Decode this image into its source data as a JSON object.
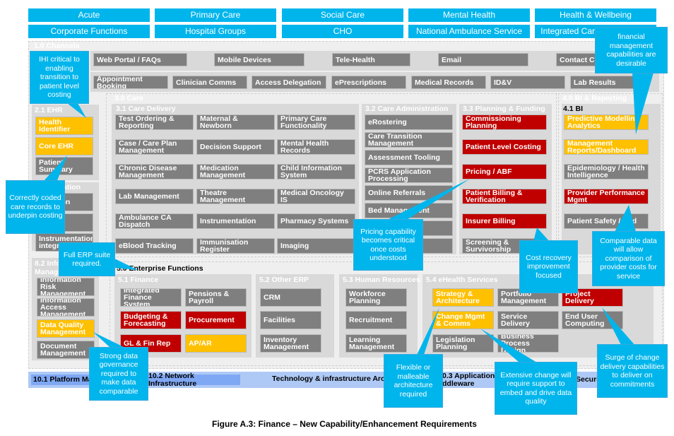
{
  "colors": {
    "gray": "#7f7f7f",
    "red": "#c00000",
    "yellow": "#ffc000",
    "callout": "#00b5ec",
    "panel": "#d9d9d9"
  },
  "top_row1": [
    "Acute",
    "Primary Care",
    "Social Care",
    "Mental Health",
    "Health & Wellbeing"
  ],
  "top_row2": [
    "Corporate Functions",
    "Hospital Groups",
    "CHO",
    "National Ambulance Service",
    "Integrated Care Programmes"
  ],
  "channels": {
    "title": "1.0 Channels",
    "row1": [
      "Web Portal / FAQs",
      "Mobile Devices",
      "Tele-Health",
      "Email",
      "Contact Ce"
    ],
    "row2": [
      "Appointment Booking",
      "Clinician Comms",
      "Access Delegation",
      "ePrescriptions",
      "Medical Records",
      "ID&V",
      "Lab Results"
    ]
  },
  "ehr": {
    "title": "2.1 EHR",
    "items": [
      {
        "label": "Health Identifier",
        "color": "yellow"
      },
      {
        "label": "Core EHR",
        "color": "yellow"
      },
      {
        "label": "Patient Summary",
        "color": "gray"
      }
    ]
  },
  "ehr2": {
    "title": "ation",
    "items": [
      {
        "label": "etting on",
        "color": "gray"
      },
      {
        "label": "on",
        "color": "gray"
      },
      {
        "label": "Instrumentation integra",
        "color": "gray"
      }
    ]
  },
  "info": {
    "title": "8.2 Info Manag",
    "items": [
      {
        "label": "Information Risk Management",
        "color": "gray"
      },
      {
        "label": "Information Access Management",
        "color": "gray"
      },
      {
        "label": "Data Quality Management",
        "color": "yellow"
      },
      {
        "label": "Document Management",
        "color": "gray"
      }
    ]
  },
  "care": {
    "title": "3.0 Care",
    "delivery": {
      "title": "3.1 Care Delivery",
      "items": [
        {
          "label": "Test Ordering & Reporting",
          "color": "gray"
        },
        {
          "label": "Maternal & Newborn",
          "color": "gray"
        },
        {
          "label": "Primary Care Functionality",
          "color": "gray"
        },
        {
          "label": "Case / Care Plan Management",
          "color": "gray"
        },
        {
          "label": "Decision Support",
          "color": "gray"
        },
        {
          "label": "Mental Health Records",
          "color": "gray"
        },
        {
          "label": "Chronic Disease Management",
          "color": "gray"
        },
        {
          "label": "Medication Management",
          "color": "gray"
        },
        {
          "label": "Child Information System",
          "color": "gray"
        },
        {
          "label": "Lab Management",
          "color": "gray"
        },
        {
          "label": "Theatre Management",
          "color": "gray"
        },
        {
          "label": "Medical Oncology IS",
          "color": "gray"
        },
        {
          "label": "Ambulance CA Dispatch",
          "color": "gray"
        },
        {
          "label": "Instrumentation",
          "color": "gray"
        },
        {
          "label": "Pharmacy Systems",
          "color": "gray"
        },
        {
          "label": "eBlood Tracking",
          "color": "gray"
        },
        {
          "label": "Immunisation Register",
          "color": "gray"
        },
        {
          "label": "Imaging",
          "color": "gray"
        }
      ]
    },
    "admin": {
      "title": "3.2 Care Administration",
      "items": [
        {
          "label": "eRostering",
          "color": "gray"
        },
        {
          "label": "Care Transition Management",
          "color": "gray"
        },
        {
          "label": "Assessment Tooling",
          "color": "gray"
        },
        {
          "label": "PCRS Application Processing",
          "color": "gray"
        },
        {
          "label": "Online Referrals",
          "color": "gray"
        },
        {
          "label": "Bed Management",
          "color": "gray"
        },
        {
          "label": "",
          "color": "gray"
        },
        {
          "label": "nt",
          "color": "gray"
        }
      ]
    },
    "planning": {
      "title": "3.3 Planning & Funding",
      "items": [
        {
          "label": "Commissioning Planning",
          "color": "red"
        },
        {
          "label": "Patient Level Costing",
          "color": "red"
        },
        {
          "label": "Pricing / ABF",
          "color": "red"
        },
        {
          "label": "Patient Billing & Verification",
          "color": "red"
        },
        {
          "label": "Insurer Billing",
          "color": "red"
        },
        {
          "label": "Screening & Survivorship",
          "color": "gray"
        }
      ]
    }
  },
  "bi": {
    "title": "4.0 BI & Reporting",
    "sub": "4.1 BI",
    "items": [
      {
        "label": "Predictive Modelling Analytics",
        "color": "yellow"
      },
      {
        "label": "Management Reports/Dashboard",
        "color": "yellow"
      },
      {
        "label": "Epidemiology / Health Intelligence",
        "color": "gray"
      },
      {
        "label": "Provider Performance Mgmt",
        "color": "red"
      },
      {
        "label": "Patient Safety / Aud",
        "color": "gray"
      }
    ]
  },
  "enterprise": {
    "title": "5.0 Enterprise Functions",
    "finance": {
      "title": "5.1 Finance",
      "items": [
        {
          "label": "Integrated Finance System",
          "color": "gray"
        },
        {
          "label": "Pensions & Payroll",
          "color": "gray"
        },
        {
          "label": "Budgeting & Forecasting",
          "color": "red"
        },
        {
          "label": "Procurement",
          "color": "red"
        },
        {
          "label": "GL & Fin Rep",
          "color": "red"
        },
        {
          "label": "AP/AR",
          "color": "yellow"
        }
      ]
    },
    "erp": {
      "title": "5.2 Other ERP",
      "items": [
        {
          "label": "CRM",
          "color": "gray"
        },
        {
          "label": "Facilities",
          "color": "gray"
        },
        {
          "label": "Inventory Management",
          "color": "gray"
        }
      ]
    },
    "hr": {
      "title": "5.3 Human Resources",
      "items": [
        {
          "label": "Workforce Planning",
          "color": "gray"
        },
        {
          "label": "Recruitment",
          "color": "gray"
        },
        {
          "label": "Learning Management",
          "color": "gray"
        }
      ]
    },
    "ehealth": {
      "title": "5.4 eHealth Services",
      "items": [
        {
          "label": "Strategy & Architecture",
          "color": "yellow"
        },
        {
          "label": "Portfolio Management",
          "color": "gray"
        },
        {
          "label": "Project Delivery",
          "color": "red"
        },
        {
          "label": "Change Mgmt & Comms",
          "color": "yellow"
        },
        {
          "label": "Service Delivery",
          "color": "gray"
        },
        {
          "label": "End User Computing",
          "color": "gray"
        },
        {
          "label": "Legislation Planning",
          "color": "gray"
        },
        {
          "label": "Business Process Design",
          "color": "gray"
        }
      ]
    }
  },
  "tech": {
    "platform": "10.1 Platform Ma",
    "network": "10.2 Network Infrastructure",
    "arch": "Technology & infrastructure Archi",
    "middleware": "0.3 Application ddleware",
    "security": "Securi"
  },
  "callouts": {
    "ihi": "IHI critical to enabling transition to patient level costing",
    "coded": "Correctly coded care records to underpin costing",
    "erp": "Full ERP suite required.",
    "governance": "Strong data governance required to make data comparable",
    "pricing": "Pricing capability becomes critical once costs understood",
    "cost": "Cost recovery improvement focused",
    "financial": "financial management capabilities are desirable",
    "comparable": "Comparable data will allow comparison of provider costs for service",
    "flexible": "Flexible or malleable architecture required",
    "extensive": "Extensive change will require support to embed and drive data quality",
    "surge": "Surge of change delivery capabilities to deliver on commitments"
  },
  "caption": "Figure A.3: Finance – New Capability/Enhancement Requirements"
}
